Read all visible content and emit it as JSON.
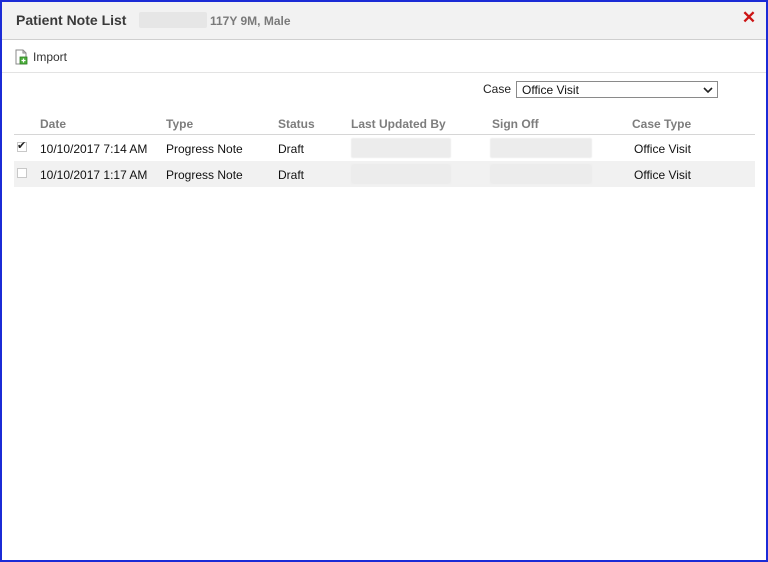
{
  "window": {
    "title": "Patient Note List",
    "patient_info": "117Y 9M, Male",
    "close_label": "✕",
    "colors": {
      "border": "#1b2bd6",
      "close": "#cc1414",
      "header_text": "#7d7d7d"
    }
  },
  "toolbar": {
    "import_label": "Import",
    "import_icon": "import-document-icon"
  },
  "filter": {
    "case_label": "Case",
    "case_value": "Office Visit"
  },
  "table": {
    "columns": [
      "Date",
      "Type",
      "Status",
      "Last Updated By",
      "Sign Off",
      "Case Type"
    ],
    "rows": [
      {
        "checked": true,
        "date": "10/10/2017 7:14 AM",
        "type": "Progress Note",
        "status": "Draft",
        "case_type": "Office Visit"
      },
      {
        "checked": false,
        "date": "10/10/2017 1:17 AM",
        "type": "Progress Note",
        "status": "Draft",
        "case_type": "Office Visit"
      }
    ]
  }
}
